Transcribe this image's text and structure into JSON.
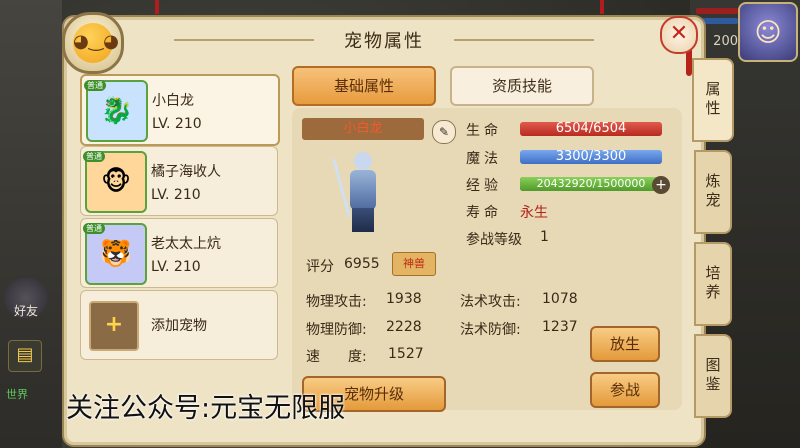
{
  "hud": {
    "right_number": "200",
    "friend_label": "好友",
    "world_label": "世界"
  },
  "window": {
    "title": "宠物属性",
    "close_symbol": "✕"
  },
  "pets": [
    {
      "name": "小白龙",
      "level": "LV. 210",
      "badge": "普通",
      "avatar": "🐉",
      "border": "#5aa23c",
      "bg": "#c9e3ff"
    },
    {
      "name": "橘子海收人",
      "level": "LV. 210",
      "badge": "普通",
      "avatar": "🐵",
      "border": "#5aa23c",
      "bg": "#ffd79a"
    },
    {
      "name": "老太太上炕",
      "level": "LV. 210",
      "badge": "普通",
      "avatar": "🐯",
      "border": "#5aa23c",
      "bg": "#c4c9f5"
    }
  ],
  "add_pet": {
    "label": "添加宠物",
    "symbol": "+"
  },
  "tabs": {
    "basic": "基础属性",
    "skills": "资质技能"
  },
  "detail": {
    "pet_name": "小白龙",
    "edit_symbol": "✎",
    "rating_label": "评分",
    "rating_value": "6955",
    "rating_badge": "神兽",
    "hp_label": "生命",
    "hp_value": "6504/6504",
    "mp_label": "魔法",
    "mp_value": "3300/3300",
    "exp_label": "经验",
    "exp_value": "20432920/1500000",
    "exp_fill": 1.0,
    "exp_plus": "+",
    "life_label": "寿命",
    "life_value": "永生",
    "battle_level_label": "参战等级",
    "battle_level_value": "1",
    "phys_atk_label": "物理攻击:",
    "phys_atk_value": "1938",
    "mag_atk_label": "法术攻击:",
    "mag_atk_value": "1078",
    "phys_def_label": "物理防御:",
    "phys_def_value": "2228",
    "mag_def_label": "法术防御:",
    "mag_def_value": "1237",
    "speed_label": "速　　度:",
    "speed_value": "1527"
  },
  "buttons": {
    "release": "放生",
    "battle": "参战",
    "bottom": "宠物升级"
  },
  "side_tabs": [
    "属性",
    "炼宠",
    "培养",
    "图鉴"
  ],
  "watermark": "关注公众号:元宝无限服",
  "colors": {
    "hp": "#c62f24",
    "mp": "#4a7bd0",
    "exp": "#5aa02c",
    "accent": "#e79b3e"
  }
}
